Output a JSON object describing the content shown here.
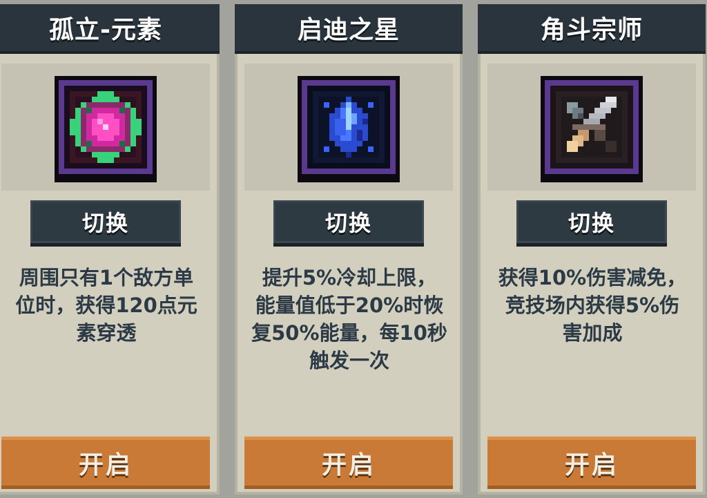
{
  "cards": [
    {
      "title": "孤立-元素",
      "icon": "pink-green-gem-icon",
      "switch_label": "切换",
      "desc_lines": [
        "周围只有1个敌方单",
        "位时，获得120点元",
        "素穿透"
      ],
      "open_label": "开启"
    },
    {
      "title": "启迪之星",
      "icon": "blue-crystal-icon",
      "switch_label": "切换",
      "desc_lines": [
        "提升5%冷却上限，",
        "能量值低于20%时恢",
        "复50%能量，每10秒",
        "触发一次"
      ],
      "open_label": "开启"
    },
    {
      "title": "角斗宗师",
      "icon": "crossed-swords-icon",
      "switch_label": "切换",
      "desc_lines": [
        "获得10%伤害减免，",
        "竞技场内获得5%伤",
        "害加成"
      ],
      "open_label": "开启"
    }
  ],
  "colors": {
    "header_bg": "#29343c",
    "card_bg": "#d3cfbf",
    "open_button": "#c97a36",
    "switch_button": "#2e3a42",
    "desc_text": "#2c3a46",
    "icon_frame": "#5a3a8e"
  }
}
